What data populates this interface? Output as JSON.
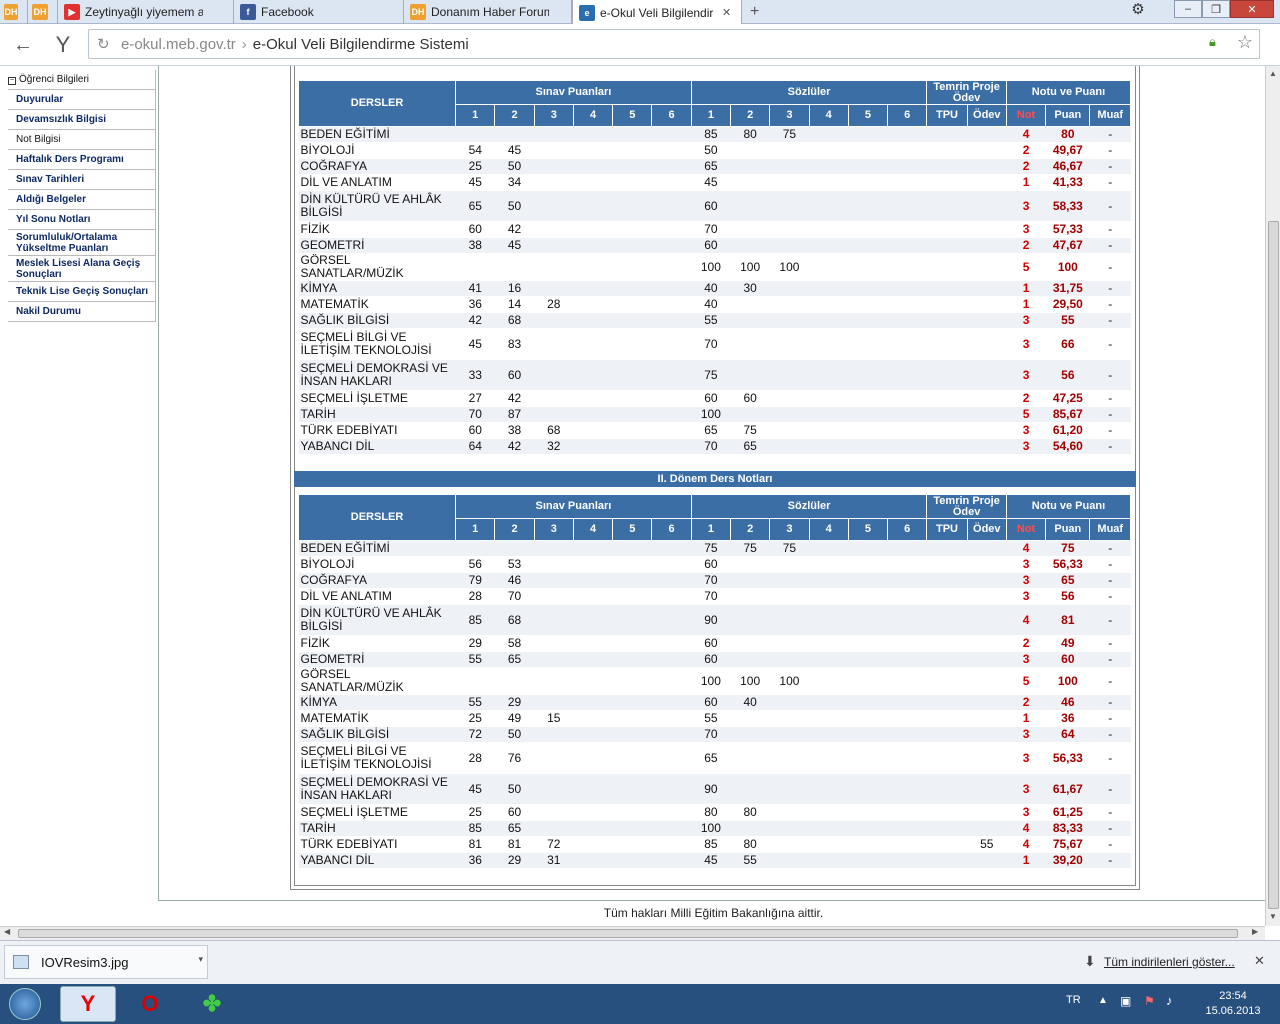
{
  "browser": {
    "tabs": [
      {
        "label": "",
        "icon": "dh-logo-icon",
        "color": "#f0a030",
        "badge": "DH"
      },
      {
        "label": "",
        "icon": "dh-logo-icon",
        "color": "#f0a030",
        "badge": "DH"
      },
      {
        "label": "Zeytinyağlı yiyemem a",
        "icon": "youtube-icon",
        "color": "#e03030",
        "badge": "▶"
      },
      {
        "label": "Facebook",
        "icon": "facebook-icon",
        "color": "#3b5998",
        "badge": "f"
      },
      {
        "label": "Donanım Haber Forum",
        "icon": "dh-logo-icon",
        "color": "#f0a030",
        "badge": "DH"
      },
      {
        "label": "e-Okul Veli Bilgilendir",
        "icon": "eokul-icon",
        "color": "#2a6db0",
        "badge": "e"
      }
    ],
    "new_tab": "+",
    "address_domain": "e-okul.meb.gov.tr",
    "address_sep": "›",
    "address_title": "e-Okul Veli Bilgilendirme Sistemi"
  },
  "sidebar": {
    "header": "Öğrenci Bilgileri",
    "items": [
      "Duyurular",
      "Devamsızlık Bilgisi",
      "Not Bilgisi",
      "Haftalık Ders Programı",
      "Sınav Tarihleri",
      "Aldığı Belgeler",
      "Yıl Sonu Notları",
      "Sorumluluk/Ortalama Yükseltme Puanları",
      "Meslek Lisesi Alana Geçiş Sonuçları",
      "Teknik Lise Geçiş Sonuçları",
      "Nakil Durumu"
    ]
  },
  "table_headers": {
    "dersler": "DERSLER",
    "sinav": "Sınav Puanları",
    "sozlu": "Sözlüler",
    "temrin": "Temrin Proje Ödev",
    "notu": "Notu ve Puanı",
    "nums6": [
      "1",
      "2",
      "3",
      "4",
      "5",
      "6"
    ],
    "tpu": "TPU",
    "odev": "Ödev",
    "not": "Not",
    "puan": "Puan",
    "muaf": "Muaf"
  },
  "donem1": [
    {
      "ders": "BEDEN EĞİTİMİ",
      "s": [
        "",
        "",
        "",
        "",
        "",
        ""
      ],
      "z": [
        "85",
        "80",
        "75",
        "",
        "",
        ""
      ],
      "tpu": "",
      "odev": "",
      "not": "4",
      "puan": "80",
      "muaf": "-"
    },
    {
      "ders": "BİYOLOJİ",
      "s": [
        "54",
        "45",
        "",
        "",
        "",
        ""
      ],
      "z": [
        "50",
        "",
        "",
        "",
        "",
        ""
      ],
      "tpu": "",
      "odev": "",
      "not": "2",
      "puan": "49,67",
      "muaf": "-"
    },
    {
      "ders": "COĞRAFYA",
      "s": [
        "25",
        "50",
        "",
        "",
        "",
        ""
      ],
      "z": [
        "65",
        "",
        "",
        "",
        "",
        ""
      ],
      "tpu": "",
      "odev": "",
      "not": "2",
      "puan": "46,67",
      "muaf": "-"
    },
    {
      "ders": "DİL VE ANLATIM",
      "s": [
        "45",
        "34",
        "",
        "",
        "",
        ""
      ],
      "z": [
        "45",
        "",
        "",
        "",
        "",
        ""
      ],
      "tpu": "",
      "odev": "",
      "not": "1",
      "puan": "41,33",
      "muaf": "-"
    },
    {
      "ders": "DİN KÜLTÜRÜ VE AHLÂK BİLGİSİ",
      "s": [
        "65",
        "50",
        "",
        "",
        "",
        ""
      ],
      "z": [
        "60",
        "",
        "",
        "",
        "",
        ""
      ],
      "tpu": "",
      "odev": "",
      "not": "3",
      "puan": "58,33",
      "muaf": "-",
      "tall": true
    },
    {
      "ders": "FİZİK",
      "s": [
        "60",
        "42",
        "",
        "",
        "",
        ""
      ],
      "z": [
        "70",
        "",
        "",
        "",
        "",
        ""
      ],
      "tpu": "",
      "odev": "",
      "not": "3",
      "puan": "57,33",
      "muaf": "-"
    },
    {
      "ders": "GEOMETRİ",
      "s": [
        "38",
        "45",
        "",
        "",
        "",
        ""
      ],
      "z": [
        "60",
        "",
        "",
        "",
        "",
        ""
      ],
      "tpu": "",
      "odev": "",
      "not": "2",
      "puan": "47,67",
      "muaf": "-"
    },
    {
      "ders": "GÖRSEL SANATLAR/MÜZİK",
      "s": [
        "",
        "",
        "",
        "",
        "",
        ""
      ],
      "z": [
        "100",
        "100",
        "100",
        "",
        "",
        ""
      ],
      "tpu": "",
      "odev": "",
      "not": "5",
      "puan": "100",
      "muaf": "-"
    },
    {
      "ders": "KİMYA",
      "s": [
        "41",
        "16",
        "",
        "",
        "",
        ""
      ],
      "z": [
        "40",
        "30",
        "",
        "",
        "",
        ""
      ],
      "tpu": "",
      "odev": "",
      "not": "1",
      "puan": "31,75",
      "muaf": "-"
    },
    {
      "ders": "MATEMATİK",
      "s": [
        "36",
        "14",
        "28",
        "",
        "",
        ""
      ],
      "z": [
        "40",
        "",
        "",
        "",
        "",
        ""
      ],
      "tpu": "",
      "odev": "",
      "not": "1",
      "puan": "29,50",
      "muaf": "-"
    },
    {
      "ders": "SAĞLIK BİLGİSİ",
      "s": [
        "42",
        "68",
        "",
        "",
        "",
        ""
      ],
      "z": [
        "55",
        "",
        "",
        "",
        "",
        ""
      ],
      "tpu": "",
      "odev": "",
      "not": "3",
      "puan": "55",
      "muaf": "-"
    },
    {
      "ders": "SEÇMELİ BİLGİ VE İLETİŞİM TEKNOLOJİSİ",
      "s": [
        "45",
        "83",
        "",
        "",
        "",
        ""
      ],
      "z": [
        "70",
        "",
        "",
        "",
        "",
        ""
      ],
      "tpu": "",
      "odev": "",
      "not": "3",
      "puan": "66",
      "muaf": "-",
      "tall": true
    },
    {
      "ders": "SEÇMELİ DEMOKRASİ VE İNSAN HAKLARI",
      "s": [
        "33",
        "60",
        "",
        "",
        "",
        ""
      ],
      "z": [
        "75",
        "",
        "",
        "",
        "",
        ""
      ],
      "tpu": "",
      "odev": "",
      "not": "3",
      "puan": "56",
      "muaf": "-",
      "tall": true
    },
    {
      "ders": "SEÇMELİ İŞLETME",
      "s": [
        "27",
        "42",
        "",
        "",
        "",
        ""
      ],
      "z": [
        "60",
        "60",
        "",
        "",
        "",
        ""
      ],
      "tpu": "",
      "odev": "",
      "not": "2",
      "puan": "47,25",
      "muaf": "-"
    },
    {
      "ders": "TARİH",
      "s": [
        "70",
        "87",
        "",
        "",
        "",
        ""
      ],
      "z": [
        "100",
        "",
        "",
        "",
        "",
        ""
      ],
      "tpu": "",
      "odev": "",
      "not": "5",
      "puan": "85,67",
      "muaf": "-"
    },
    {
      "ders": "TÜRK EDEBİYATI",
      "s": [
        "60",
        "38",
        "68",
        "",
        "",
        ""
      ],
      "z": [
        "65",
        "75",
        "",
        "",
        "",
        ""
      ],
      "tpu": "",
      "odev": "",
      "not": "3",
      "puan": "61,20",
      "muaf": "-"
    },
    {
      "ders": "YABANCI DİL",
      "s": [
        "64",
        "42",
        "32",
        "",
        "",
        ""
      ],
      "z": [
        "70",
        "65",
        "",
        "",
        "",
        ""
      ],
      "tpu": "",
      "odev": "",
      "not": "3",
      "puan": "54,60",
      "muaf": "-"
    }
  ],
  "donem2_title": "II. Dönem Ders Notları",
  "donem2": [
    {
      "ders": "BEDEN EĞİTİMİ",
      "s": [
        "",
        "",
        "",
        "",
        "",
        ""
      ],
      "z": [
        "75",
        "75",
        "75",
        "",
        "",
        ""
      ],
      "tpu": "",
      "odev": "",
      "not": "4",
      "puan": "75",
      "muaf": "-"
    },
    {
      "ders": "BİYOLOJİ",
      "s": [
        "56",
        "53",
        "",
        "",
        "",
        ""
      ],
      "z": [
        "60",
        "",
        "",
        "",
        "",
        ""
      ],
      "tpu": "",
      "odev": "",
      "not": "3",
      "puan": "56,33",
      "muaf": "-"
    },
    {
      "ders": "COĞRAFYA",
      "s": [
        "79",
        "46",
        "",
        "",
        "",
        ""
      ],
      "z": [
        "70",
        "",
        "",
        "",
        "",
        ""
      ],
      "tpu": "",
      "odev": "",
      "not": "3",
      "puan": "65",
      "muaf": "-"
    },
    {
      "ders": "DİL VE ANLATIM",
      "s": [
        "28",
        "70",
        "",
        "",
        "",
        ""
      ],
      "z": [
        "70",
        "",
        "",
        "",
        "",
        ""
      ],
      "tpu": "",
      "odev": "",
      "not": "3",
      "puan": "56",
      "muaf": "-"
    },
    {
      "ders": "DİN KÜLTÜRÜ VE AHLÂK BİLGİSİ",
      "s": [
        "85",
        "68",
        "",
        "",
        "",
        ""
      ],
      "z": [
        "90",
        "",
        "",
        "",
        "",
        ""
      ],
      "tpu": "",
      "odev": "",
      "not": "4",
      "puan": "81",
      "muaf": "-",
      "tall": true
    },
    {
      "ders": "FİZİK",
      "s": [
        "29",
        "58",
        "",
        "",
        "",
        ""
      ],
      "z": [
        "60",
        "",
        "",
        "",
        "",
        ""
      ],
      "tpu": "",
      "odev": "",
      "not": "2",
      "puan": "49",
      "muaf": "-"
    },
    {
      "ders": "GEOMETRİ",
      "s": [
        "55",
        "65",
        "",
        "",
        "",
        ""
      ],
      "z": [
        "60",
        "",
        "",
        "",
        "",
        ""
      ],
      "tpu": "",
      "odev": "",
      "not": "3",
      "puan": "60",
      "muaf": "-"
    },
    {
      "ders": "GÖRSEL SANATLAR/MÜZİK",
      "s": [
        "",
        "",
        "",
        "",
        "",
        ""
      ],
      "z": [
        "100",
        "100",
        "100",
        "",
        "",
        ""
      ],
      "tpu": "",
      "odev": "",
      "not": "5",
      "puan": "100",
      "muaf": "-"
    },
    {
      "ders": "KİMYA",
      "s": [
        "55",
        "29",
        "",
        "",
        "",
        ""
      ],
      "z": [
        "60",
        "40",
        "",
        "",
        "",
        ""
      ],
      "tpu": "",
      "odev": "",
      "not": "2",
      "puan": "46",
      "muaf": "-"
    },
    {
      "ders": "MATEMATİK",
      "s": [
        "25",
        "49",
        "15",
        "",
        "",
        ""
      ],
      "z": [
        "55",
        "",
        "",
        "",
        "",
        ""
      ],
      "tpu": "",
      "odev": "",
      "not": "1",
      "puan": "36",
      "muaf": "-"
    },
    {
      "ders": "SAĞLIK BİLGİSİ",
      "s": [
        "72",
        "50",
        "",
        "",
        "",
        ""
      ],
      "z": [
        "70",
        "",
        "",
        "",
        "",
        ""
      ],
      "tpu": "",
      "odev": "",
      "not": "3",
      "puan": "64",
      "muaf": "-"
    },
    {
      "ders": "SEÇMELİ BİLGİ VE İLETİŞİM TEKNOLOJİSİ",
      "s": [
        "28",
        "76",
        "",
        "",
        "",
        ""
      ],
      "z": [
        "65",
        "",
        "",
        "",
        "",
        ""
      ],
      "tpu": "",
      "odev": "",
      "not": "3",
      "puan": "56,33",
      "muaf": "-",
      "tall": true
    },
    {
      "ders": "SEÇMELİ DEMOKRASİ VE İNSAN HAKLARI",
      "s": [
        "45",
        "50",
        "",
        "",
        "",
        ""
      ],
      "z": [
        "90",
        "",
        "",
        "",
        "",
        ""
      ],
      "tpu": "",
      "odev": "",
      "not": "3",
      "puan": "61,67",
      "muaf": "-",
      "tall": true
    },
    {
      "ders": "SEÇMELİ İŞLETME",
      "s": [
        "25",
        "60",
        "",
        "",
        "",
        ""
      ],
      "z": [
        "80",
        "80",
        "",
        "",
        "",
        ""
      ],
      "tpu": "",
      "odev": "",
      "not": "3",
      "puan": "61,25",
      "muaf": "-"
    },
    {
      "ders": "TARİH",
      "s": [
        "85",
        "65",
        "",
        "",
        "",
        ""
      ],
      "z": [
        "100",
        "",
        "",
        "",
        "",
        ""
      ],
      "tpu": "",
      "odev": "",
      "not": "4",
      "puan": "83,33",
      "muaf": "-"
    },
    {
      "ders": "TÜRK EDEBİYATI",
      "s": [
        "81",
        "81",
        "72",
        "",
        "",
        ""
      ],
      "z": [
        "85",
        "80",
        "",
        "",
        "",
        ""
      ],
      "tpu": "",
      "odev": "55",
      "not": "4",
      "puan": "75,67",
      "muaf": "-"
    },
    {
      "ders": "YABANCI DİL",
      "s": [
        "36",
        "29",
        "31",
        "",
        "",
        ""
      ],
      "z": [
        "45",
        "55",
        "",
        "",
        "",
        ""
      ],
      "tpu": "",
      "odev": "",
      "not": "1",
      "puan": "39,20",
      "muaf": "-"
    }
  ],
  "footer": "Tüm hakları Milli Eğitim Bakanlığına aittir.",
  "download": {
    "file": "IOVResim3.jpg",
    "show_all": "Tüm indirilenleri göster..."
  },
  "taskbar": {
    "lang": "TR",
    "time": "23:54",
    "date": "15.06.2013"
  },
  "colors": {
    "header_blue": "#3a6ea5",
    "not_red": "#d40000",
    "puan_red": "#a00000"
  }
}
